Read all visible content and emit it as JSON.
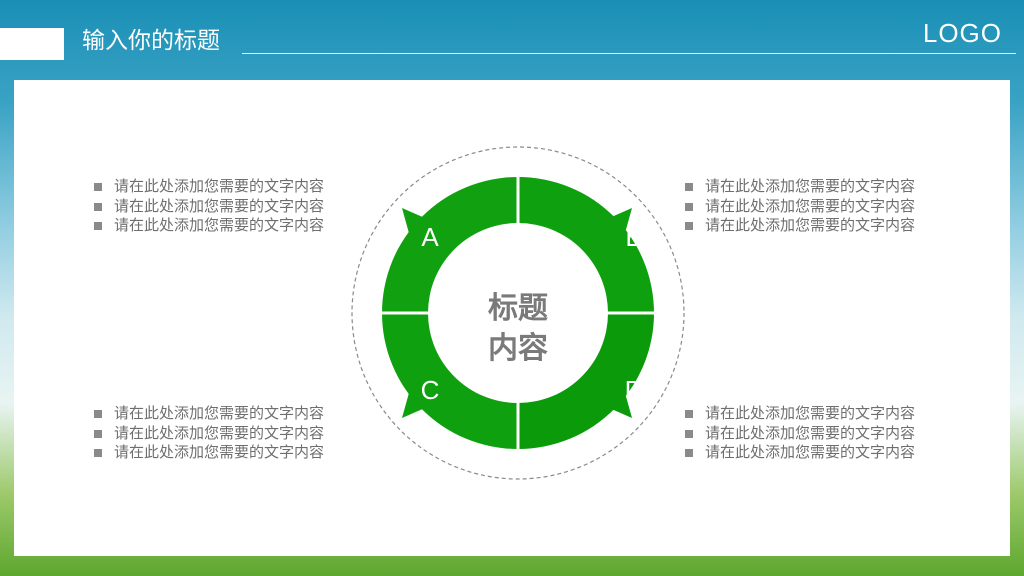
{
  "header": {
    "title": "输入你的标题",
    "logo": "LOGO"
  },
  "center": {
    "line1": "标题",
    "line2": "内容"
  },
  "segments": [
    {
      "label": "A"
    },
    {
      "label": "B"
    },
    {
      "label": "C"
    },
    {
      "label": "D"
    }
  ],
  "blocks": {
    "top_left": [
      "请在此处添加您需要的文字内容",
      "请在此处添加您需要的文字内容",
      "请在此处添加您需要的文字内容"
    ],
    "top_right": [
      "请在此处添加您需要的文字内容",
      "请在此处添加您需要的文字内容",
      "请在此处添加您需要的文字内容"
    ],
    "bottom_left": [
      "请在此处添加您需要的文字内容",
      "请在此处添加您需要的文字内容",
      "请在此处添加您需要的文字内容"
    ],
    "bottom_right": [
      "请在此处添加您需要的文字内容",
      "请在此处添加您需要的文字内容",
      "请在此处添加您需要的文字内容"
    ]
  },
  "colors": {
    "ring": "#10a010",
    "ring_dark": "#0a9a0a",
    "text_gray": "#6e6e6e",
    "center_text": "#7a7a7a"
  }
}
